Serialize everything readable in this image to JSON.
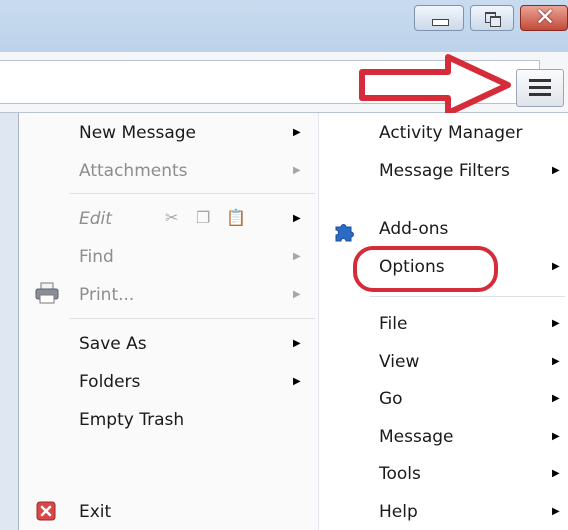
{
  "window": {
    "minimize_glyph": "",
    "close_glyph": "✕"
  },
  "toolbar": {
    "search_glyph": "⌕"
  },
  "left_menu": {
    "items": [
      {
        "label": "New Message",
        "enabled": true,
        "has_submenu": true
      },
      {
        "label": "Attachments",
        "enabled": false,
        "has_submenu": true
      },
      {
        "label": "Edit",
        "enabled": false,
        "italic": true,
        "has_submenu": true
      },
      {
        "label": "Find",
        "enabled": false,
        "has_submenu": true
      },
      {
        "label": "Print...",
        "enabled": false,
        "has_submenu": true,
        "icon": "printer-icon"
      },
      {
        "label": "Save As",
        "enabled": true,
        "has_submenu": true
      },
      {
        "label": "Folders",
        "enabled": true,
        "has_submenu": true
      },
      {
        "label": "Empty Trash",
        "enabled": true,
        "has_submenu": false
      },
      {
        "label": "Exit",
        "enabled": true,
        "has_submenu": false,
        "icon": "exit-icon"
      }
    ],
    "edit_tool_icons": [
      "cut-icon",
      "copy-icon",
      "paste-icon"
    ]
  },
  "right_menu": {
    "items": [
      {
        "label": "Activity Manager",
        "has_submenu": false
      },
      {
        "label": "Message Filters",
        "has_submenu": true
      },
      {
        "label": "Add-ons",
        "has_submenu": false,
        "icon": "puzzle-piece-icon"
      },
      {
        "label": "Options",
        "has_submenu": true,
        "highlighted": true
      },
      {
        "label": "File",
        "has_submenu": true
      },
      {
        "label": "View",
        "has_submenu": true
      },
      {
        "label": "Go",
        "has_submenu": true
      },
      {
        "label": "Message",
        "has_submenu": true
      },
      {
        "label": "Tools",
        "has_submenu": true
      },
      {
        "label": "Help",
        "has_submenu": true
      }
    ]
  },
  "annotations": {
    "color": "#d62b38",
    "arrow_points_to": "hamburger-menu-button",
    "circle_around": "Options"
  },
  "submenu_arrow": "▶"
}
